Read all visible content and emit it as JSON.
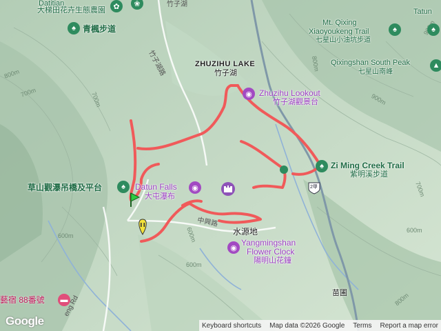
{
  "map": {
    "lake_en": "ZHUZIHU LAKE",
    "lake_zh": "竹子湖",
    "road_top": "竹子湖",
    "road_left": "竹子湖路",
    "road_zhongxing": "中興路",
    "road_bottom_left": "eng Rd",
    "area_shuiyuan": "水源地",
    "area_miaopu": "苗圃",
    "road_shield": "2甲",
    "contours": [
      "800m",
      "700m",
      "600m",
      "600m",
      "800m",
      "900m",
      "900m",
      "700m",
      "700m",
      "800m",
      "600m",
      "600m"
    ]
  },
  "pois": {
    "top_garden": "大梯田花卉生態農園",
    "qingfeng": "青楓步道",
    "datitian": "Datitian",
    "zhuzihu_lookout_en": "Zhuzihu Lookout",
    "zhuzihu_lookout_zh": "竹子湖觀景台",
    "mt_qixing_1": "Mt. Qixing",
    "mt_qixing_2": "Xiaoyoukeng Trail",
    "mt_qixing_zh": "七星山小油坑步道",
    "tatun": "Tatun",
    "south_peak_en": "Qixingshan South Peak",
    "south_peak_zh": "七星山南峰",
    "ziming_en": "Zi Ming Creek Trail",
    "ziming_zh": "紫明溪步道",
    "caoshan": "草山觀瀑吊橋及平台",
    "datun_falls_en": "Datun Falls",
    "datun_falls_zh": "大屯瀑布",
    "flower_clock_1": "Yangmingshan",
    "flower_clock_2": "Flower Clock",
    "flower_clock_zh": "陽明山花鐘",
    "yishu": "藝宿 88番號"
  },
  "attribution": {
    "logo": "Google",
    "shortcuts": "Keyboard shortcuts",
    "data": "Map data ©2026 Google",
    "terms": "Terms",
    "report": "Report a map error"
  },
  "colors": {
    "track": "#f05a5a",
    "water": "#8fb2d8",
    "terrain": "#c8dcc8"
  }
}
